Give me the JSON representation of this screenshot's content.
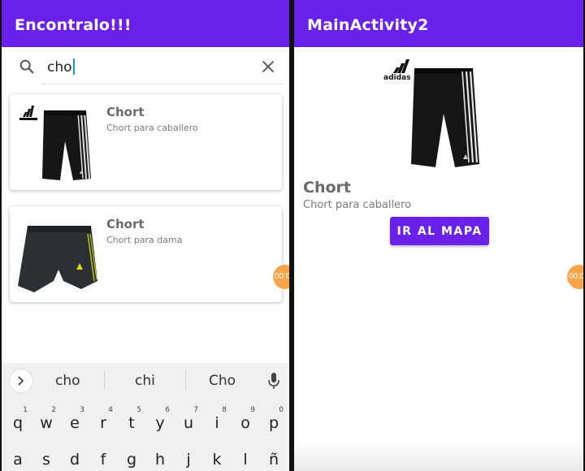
{
  "left_screen": {
    "app_bar": {
      "title": "Encontralo!!!"
    },
    "search": {
      "value": "cho",
      "icon": "search-icon",
      "clear_icon": "close-icon"
    },
    "results": [
      {
        "title": "Chort",
        "subtitle": "Chort para caballero",
        "image": "adidas black shorts with white stripes"
      },
      {
        "title": "Chort",
        "subtitle": "Chort para dama",
        "image": "dark running shorts with yellow stripes"
      }
    ],
    "timer_bubble": "00:0",
    "keyboard": {
      "suggestions": [
        "cho",
        "chi",
        "Cho"
      ],
      "row1": [
        {
          "num": "1",
          "ch": "q"
        },
        {
          "num": "2",
          "ch": "w"
        },
        {
          "num": "3",
          "ch": "e"
        },
        {
          "num": "4",
          "ch": "r"
        },
        {
          "num": "5",
          "ch": "t"
        },
        {
          "num": "6",
          "ch": "y"
        },
        {
          "num": "7",
          "ch": "u"
        },
        {
          "num": "8",
          "ch": "i"
        },
        {
          "num": "9",
          "ch": "o"
        },
        {
          "num": "0",
          "ch": "p"
        }
      ],
      "row2": [
        "a",
        "s",
        "d",
        "f",
        "g",
        "h",
        "j",
        "k",
        "l",
        "ñ"
      ]
    }
  },
  "right_screen": {
    "app_bar": {
      "title": "MainActivity2"
    },
    "product": {
      "title": "Chort",
      "subtitle": "Chort para caballero",
      "image": "adidas black shorts with white stripes",
      "brand": "adidas"
    },
    "map_button": "IR AL MAPA",
    "timer_bubble": "00:0"
  },
  "colors": {
    "primary": "#6a21ea",
    "timer": "#f7a54a",
    "caret": "#16a2a2"
  }
}
